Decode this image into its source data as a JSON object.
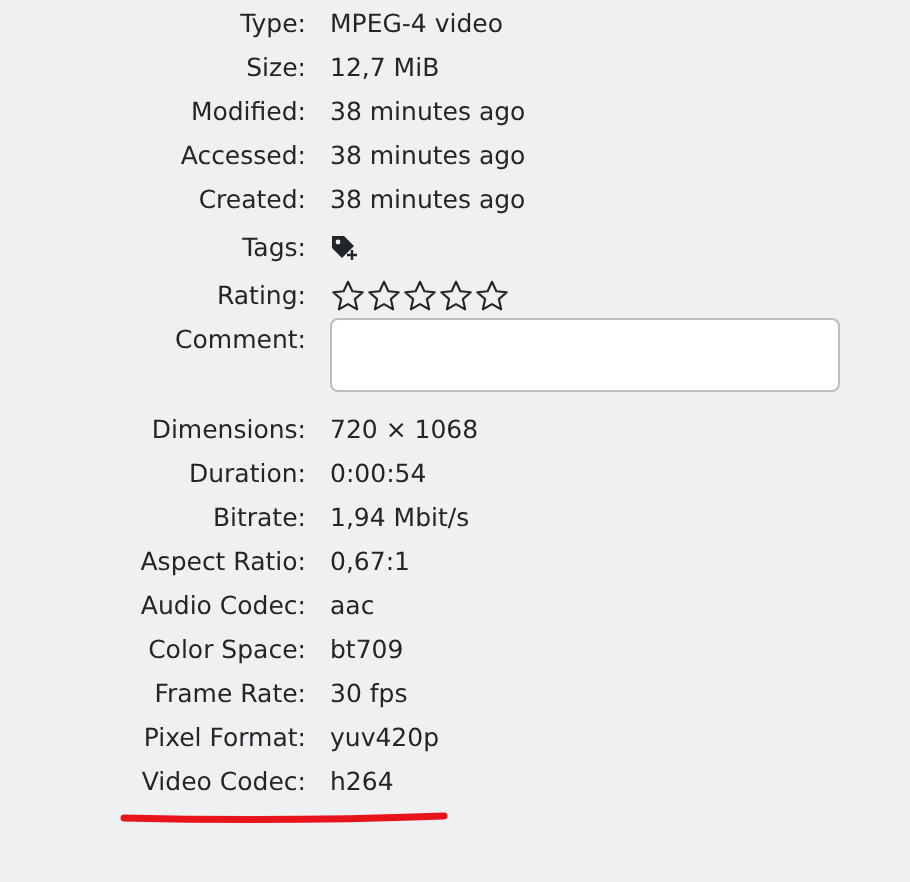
{
  "properties": [
    {
      "kind": "text",
      "label": "Type:",
      "value": "MPEG-4 video"
    },
    {
      "kind": "text",
      "label": "Size:",
      "value": "12,7 MiB"
    },
    {
      "kind": "text",
      "label": "Modified:",
      "value": "38 minutes ago"
    },
    {
      "kind": "text",
      "label": "Accessed:",
      "value": "38 minutes ago"
    },
    {
      "kind": "text",
      "label": "Created:",
      "value": "38 minutes ago"
    },
    {
      "kind": "tags",
      "label": "Tags:"
    },
    {
      "kind": "rating",
      "label": "Rating:",
      "stars": 0
    },
    {
      "kind": "comment",
      "label": "Comment:"
    },
    {
      "kind": "text",
      "label": "Dimensions:",
      "value": "720 × 1068"
    },
    {
      "kind": "text",
      "label": "Duration:",
      "value": "0:00:54"
    },
    {
      "kind": "text",
      "label": "Bitrate:",
      "value": "1,94 Mbit/s"
    },
    {
      "kind": "text",
      "label": "Aspect Ratio:",
      "value": "0,67:1"
    },
    {
      "kind": "text",
      "label": "Audio Codec:",
      "value": "aac"
    },
    {
      "kind": "text",
      "label": "Color Space:",
      "value": "bt709"
    },
    {
      "kind": "text",
      "label": "Frame Rate:",
      "value": "30 fps"
    },
    {
      "kind": "text",
      "label": "Pixel Format:",
      "value": "yuv420p"
    },
    {
      "kind": "text",
      "label": "Video Codec:",
      "value": "h264"
    }
  ]
}
